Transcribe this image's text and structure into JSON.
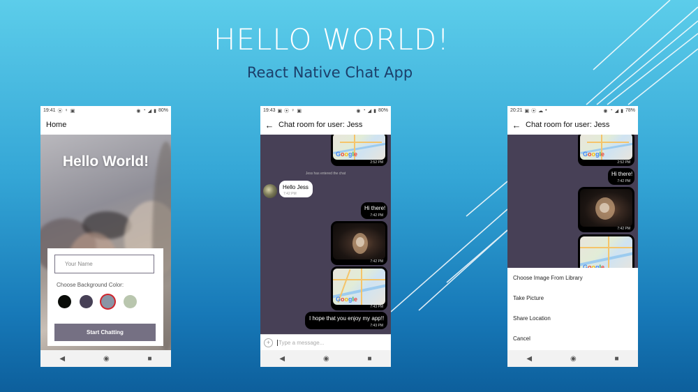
{
  "slide": {
    "title": "HELLO WORLD!",
    "subtitle": "React Native Chat App"
  },
  "phone1": {
    "status": {
      "time": "19:41",
      "battery": "80%"
    },
    "appbar_title": "Home",
    "hero_title": "Hello World!",
    "name_placeholder": "Your Name",
    "color_label": "Choose Background Color:",
    "swatches": [
      "#090C08",
      "#474056",
      "#8A95A5",
      "#B9C6AE"
    ],
    "button_label": "Start Chatting"
  },
  "phone2": {
    "status": {
      "time": "19:43",
      "battery": "80%"
    },
    "appbar_title": "Chat room for user: Jess",
    "system_message": "Jess has entered the chat",
    "messages": [
      {
        "text": "",
        "time": "2:52 PM"
      },
      {
        "text": "Hello Jess",
        "time": "7:42 PM"
      },
      {
        "text": "Hi there!",
        "time": "7:42 PM"
      },
      {
        "text": "",
        "time": "7:42 PM"
      },
      {
        "text": "",
        "time": "7:43 PM"
      },
      {
        "text": "I hope that you enjoy my app!!",
        "time": "7:43 PM"
      }
    ],
    "input_placeholder": "Type a message..."
  },
  "phone3": {
    "status": {
      "time": "20:21",
      "battery": "78%"
    },
    "appbar_title": "Chat room for user: Jess",
    "messages": [
      {
        "text": "",
        "time": "2:52 PM"
      },
      {
        "text": "Hi there!",
        "time": "7:42 PM"
      },
      {
        "text": "",
        "time": "7:42 PM"
      }
    ],
    "actions": [
      "Choose Image From Library",
      "Take Picture",
      "Share Location",
      "Cancel"
    ]
  },
  "map_logo": "Google",
  "map_label": "A102",
  "icons": {
    "back": "arrow-left-icon",
    "nav_back": "triangle-back-icon",
    "nav_home": "circle-home-icon",
    "nav_recent": "square-recent-icon",
    "add": "plus-circle-icon"
  },
  "colors": {
    "chat_bg": "#474056",
    "button_bg": "#757083",
    "bubble_right": "#000000",
    "bubble_left": "#FFFFFF"
  }
}
